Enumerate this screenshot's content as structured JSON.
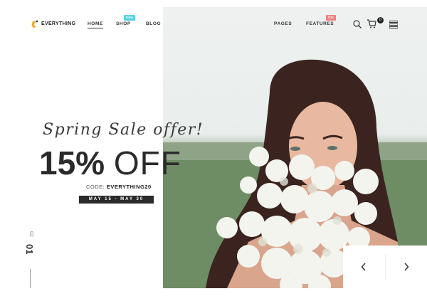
{
  "header": {
    "logo_text": "EVERYTHING",
    "nav": {
      "home": "HOME",
      "shop": "SHOP",
      "blog": "BLOG",
      "pages": "PAGES",
      "features": "FEATURES"
    },
    "badges": {
      "shop": "New",
      "features": "Hot"
    },
    "cart_count": "0",
    "icons": [
      "search-icon",
      "cart-icon",
      "menu-icon"
    ]
  },
  "promo": {
    "title": "Spring Sale offer!",
    "discount": "15%",
    "discount_word": "OFF",
    "code_label": "CODE:",
    "code_value": "EVERYTHING20",
    "dates": "MAY 15 - MAY 30"
  },
  "slider": {
    "current": "01",
    "total": "02",
    "prev_icon": "chevron-left-icon",
    "next_icon": "chevron-right-icon"
  },
  "colors": {
    "accent_new": "#5ccfe0",
    "accent_hot": "#f08080",
    "text_dark": "#2b2b2b",
    "logo_orange": "#f5a623"
  }
}
